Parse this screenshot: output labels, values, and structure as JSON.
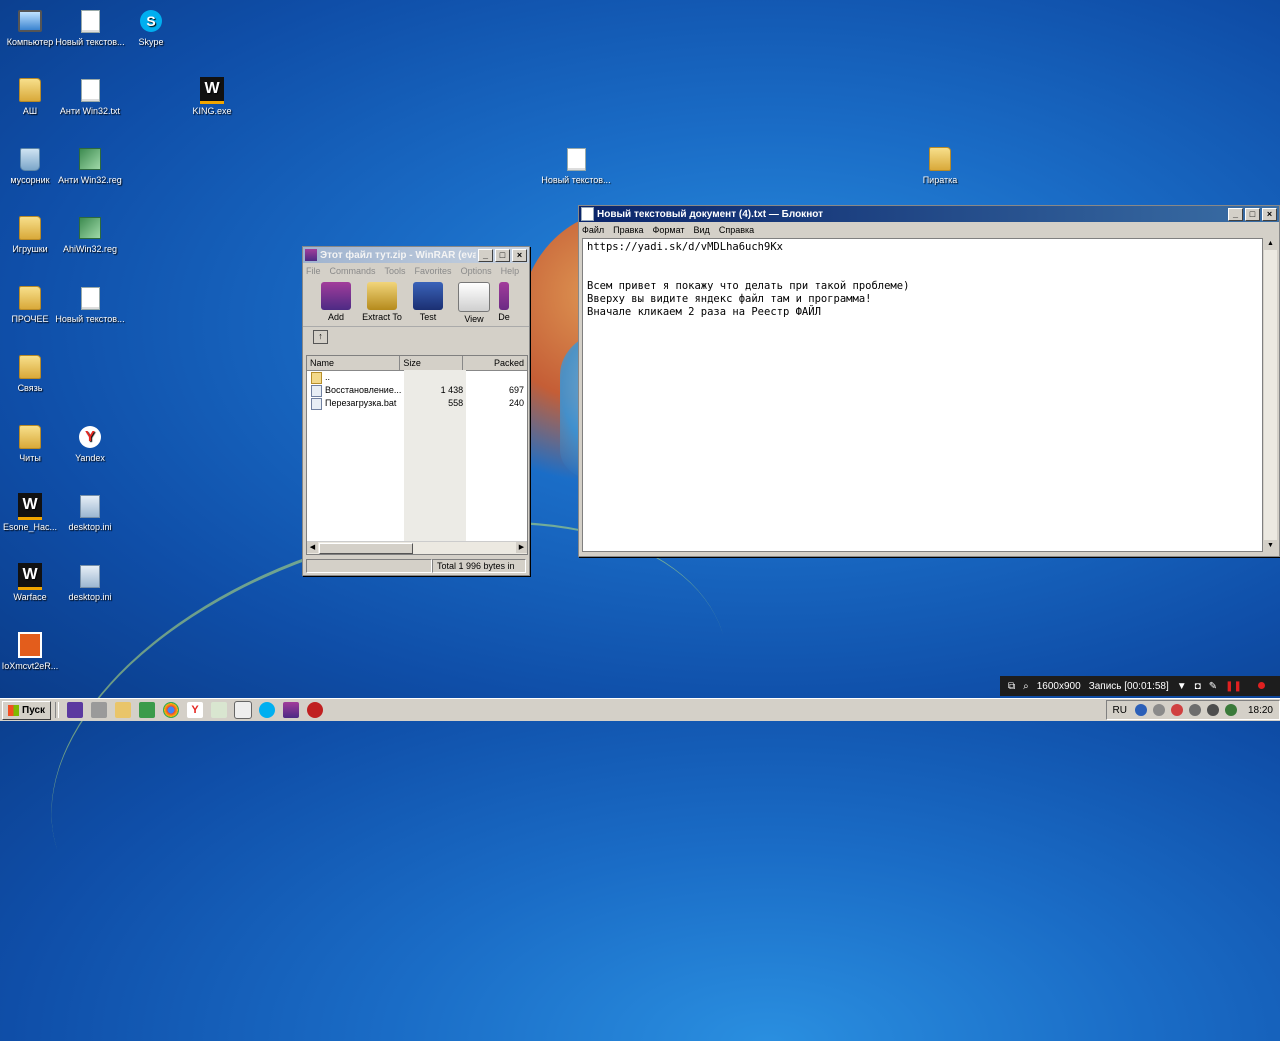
{
  "desktop": {
    "icons": [
      {
        "label": "Компьютер",
        "icon": "computer-icon"
      },
      {
        "label": "Новый текстов...",
        "icon": "text-file-icon"
      },
      {
        "label": "Skype",
        "icon": "skype-icon"
      },
      {
        "label": "АШ",
        "icon": "folder-icon"
      },
      {
        "label": "Анти Win32.txt",
        "icon": "text-file-icon"
      },
      {
        "label": "KING.exe",
        "icon": "warface-icon"
      },
      {
        "label": "мусорник",
        "icon": "recycle-bin-icon"
      },
      {
        "label": "Анти Win32.reg",
        "icon": "registry-file-icon"
      },
      {
        "label": "Новый текстов...",
        "icon": "text-file-icon"
      },
      {
        "label": "Пиратка",
        "icon": "folder-icon"
      },
      {
        "label": "Игрушки",
        "icon": "folder-icon"
      },
      {
        "label": "AhiWin32.reg",
        "icon": "registry-file-icon"
      },
      {
        "label": "ПРОЧЕЕ",
        "icon": "folder-icon"
      },
      {
        "label": "Новый текстов...",
        "icon": "text-file-icon"
      },
      {
        "label": "Связь",
        "icon": "folder-icon"
      },
      {
        "label": "Читы",
        "icon": "folder-icon"
      },
      {
        "label": "Yandex",
        "icon": "yandex-browser-icon"
      },
      {
        "label": "Esone_Hac...",
        "icon": "warface-icon"
      },
      {
        "label": "desktop.ini",
        "icon": "ini-file-icon"
      },
      {
        "label": "Warface",
        "icon": "warface-icon"
      },
      {
        "label": "desktop.ini",
        "icon": "ini-file-icon"
      },
      {
        "label": "IoXmcvt2eR...",
        "icon": "executable-icon"
      }
    ]
  },
  "winrar": {
    "title": "Этот файл тут.zip - WinRAR (eval...",
    "menu": [
      "File",
      "Commands",
      "Tools",
      "Favorites",
      "Options",
      "Help"
    ],
    "toolbar": [
      "Add",
      "Extract To",
      "Test",
      "View",
      "De"
    ],
    "columns": [
      "Name",
      "Size",
      "Packed"
    ],
    "rows": [
      {
        "name": "..",
        "size": "",
        "packed": ""
      },
      {
        "name": "Восстановление...",
        "size": "1 438",
        "packed": "697"
      },
      {
        "name": "Перезагрузка.bat",
        "size": "558",
        "packed": "240"
      }
    ],
    "status": "Total 1 996 bytes in"
  },
  "notepad": {
    "title": "Новый текстовый документ (4).txt — Блокнот",
    "menu": [
      "Файл",
      "Правка",
      "Формат",
      "Вид",
      "Справка"
    ],
    "lines": [
      "https://yadi.sk/d/vMDLha6uch9Kx",
      "Всем привет я покажу что делать при такой проблеме)",
      "Вверху вы видите яндекс файл там и программа!",
      "Вначале кликаем 2 раза на Реестр ФАЙЛ"
    ]
  },
  "recorder": {
    "resolution": "1600x900",
    "status": "Запись [00:01:58]"
  },
  "taskbar": {
    "start": "Пуск",
    "language": "RU",
    "clock": "18:20"
  }
}
